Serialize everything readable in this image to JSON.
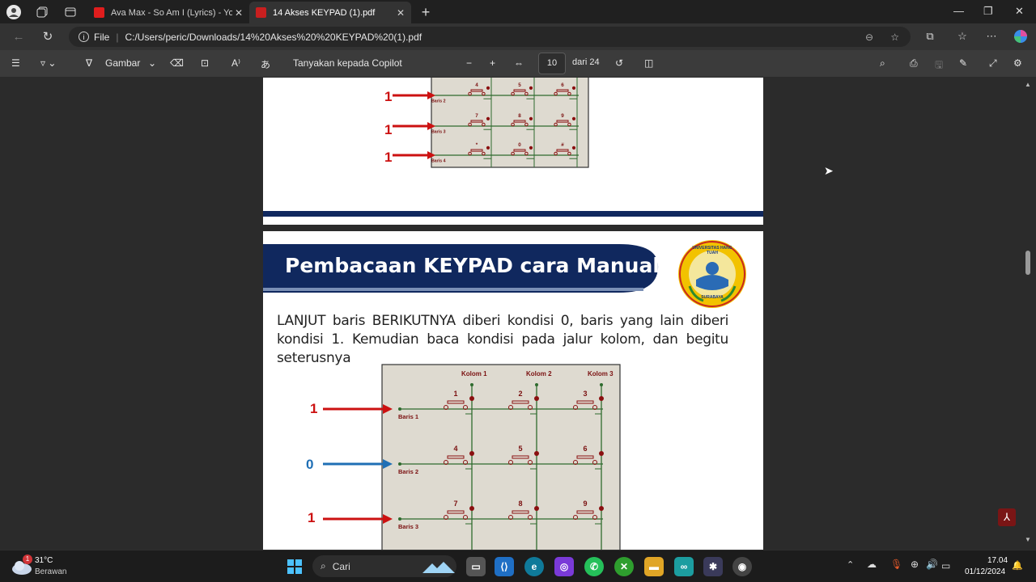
{
  "tabs": [
    {
      "title": "Ava Max - So Am I (Lyrics) - YouTu",
      "favicon_color": "#e01d1d",
      "active": false
    },
    {
      "title": "14 Akses KEYPAD (1).pdf",
      "favicon_color": "#c81f1f",
      "active": true
    }
  ],
  "address": {
    "scheme_label": "File",
    "url": "C:/Users/peric/Downloads/14%20Akses%20%20KEYPAD%20(1).pdf"
  },
  "pdf_toolbar": {
    "draw_label": "Gambar",
    "copilot_label": "Tanyakan kepada Copilot",
    "page_number": "10",
    "page_total": "dari 24"
  },
  "page_top": {
    "row_labels": [
      "Baris 2",
      "Baris 3",
      "Baris 4"
    ],
    "row_values": [
      "1",
      "1",
      "1"
    ],
    "keys": [
      [
        "4",
        "5",
        "6"
      ],
      [
        "7",
        "8",
        "9"
      ],
      [
        "*",
        "0",
        "#"
      ]
    ]
  },
  "page_main": {
    "title": "Pembacaan KEYPAD cara Manual",
    "body": "LANJUT baris BERIKUTNYA diberi kondisi 0, baris yang lain diberi kondisi 1. Kemudian baca kondisi pada jalur kolom, dan begitu seterusnya",
    "logo_text_top": "UNIVERSITAS HANG TUAH",
    "logo_text_bottom": "SURABAYA",
    "column_labels": [
      "Kolom 1",
      "Kolom 2",
      "Kolom 3"
    ],
    "row_labels": [
      "Baris 1",
      "Baris 2",
      "Baris 3"
    ],
    "row_values": [
      "1",
      "0",
      "1"
    ],
    "keys": [
      [
        "1",
        "2",
        "3"
      ],
      [
        "4",
        "5",
        "6"
      ],
      [
        "7",
        "8",
        "9"
      ]
    ]
  },
  "taskbar": {
    "temperature": "31°C",
    "weather": "Berawan",
    "weather_badge": "1",
    "search_label": "Cari",
    "time": "17.04",
    "date": "01/12/2024"
  },
  "colors": {
    "title_banner": "#10285e",
    "arrow_one": "#cc1111",
    "arrow_zero": "#1f6fb5",
    "circuit_bg": "#dedad0",
    "wire": "#2e6b2e",
    "switch": "#8a1010"
  }
}
